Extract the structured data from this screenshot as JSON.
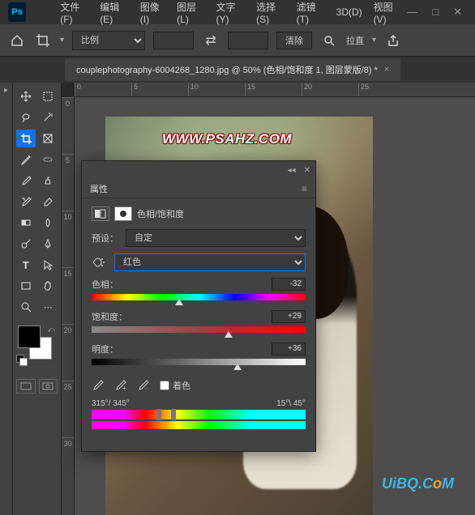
{
  "menubar": {
    "file": "文件(F)",
    "edit": "编辑(E)",
    "image": "图像(I)",
    "layer": "图层(L)",
    "type": "文字(Y)",
    "select": "选择(S)",
    "filter": "滤镜(T)",
    "threeD": "3D(D)",
    "view": "视图(V)"
  },
  "optbar": {
    "ratio_mode": "比例",
    "clear": "清除",
    "pull": "拉直"
  },
  "tab": {
    "title": "couplephotography-6004268_1280.jpg @ 50% (色相/饱和度 1, 图层蒙版/8) *"
  },
  "ruler_h": [
    "0",
    "5",
    "10",
    "15",
    "20",
    "25"
  ],
  "ruler_v": [
    "0",
    "5",
    "10",
    "15",
    "20",
    "25",
    "30"
  ],
  "watermark": "WWW.PSAHZ.COM",
  "watermark2_pre": "UiBQ.C",
  "watermark2_o": "o",
  "watermark2_post": "M",
  "panel": {
    "title": "属性",
    "adj_name": "色相/饱和度",
    "preset_label": "预设：",
    "preset_value": "自定",
    "channel_value": "红色",
    "hue_label": "色相：",
    "hue_value": "-32",
    "sat_label": "饱和度：",
    "sat_value": "+29",
    "light_label": "明度：",
    "light_value": "+36",
    "colorize": "着色",
    "range_left": "315°/ 345°",
    "range_right": "15°\\ 45°"
  }
}
